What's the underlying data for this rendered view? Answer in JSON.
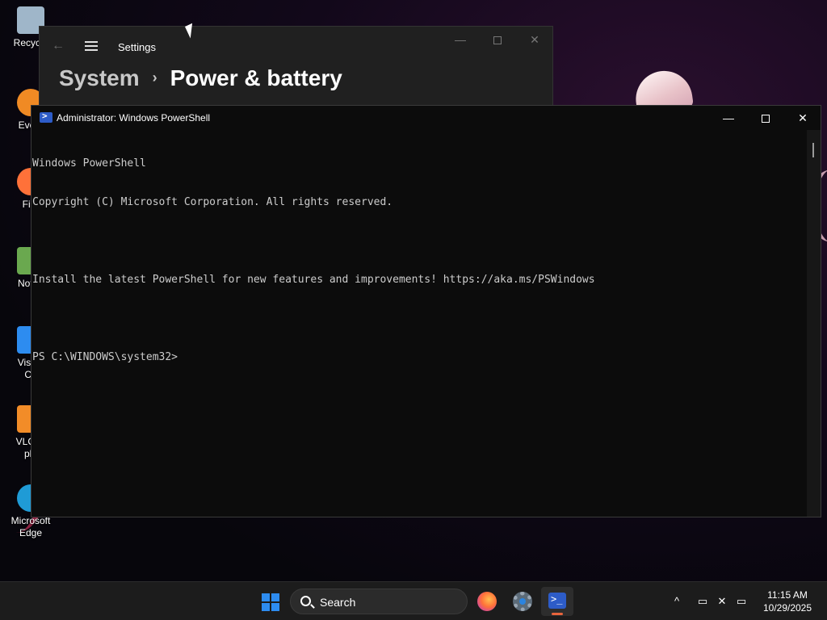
{
  "desktop": {
    "icons": [
      {
        "label": "Recycle",
        "icon": "recycle-bin-icon",
        "color": "#9fb6c9"
      },
      {
        "label": "Every",
        "icon": "everything-icon",
        "color": "#f08a24"
      },
      {
        "label": "Fire",
        "icon": "firefox-icon",
        "color": "#ff7139"
      },
      {
        "label": "Notep",
        "icon": "notepad-icon",
        "color": "#6aa84f"
      },
      {
        "label": "Visual",
        "label2": "Co",
        "icon": "vscode-icon",
        "color": "#2d8cf0"
      },
      {
        "label": "VLC m",
        "label2": "pla",
        "icon": "vlc-icon",
        "color": "#f28c28"
      },
      {
        "label": "Microsoft",
        "label2": "Edge",
        "icon": "edge-icon",
        "color": "#1f9bd6"
      }
    ]
  },
  "settings": {
    "app_title": "Settings",
    "breadcrumb": {
      "parent": "System",
      "separator": "›",
      "current": "Power & battery"
    },
    "buttons": {
      "back": "←",
      "minimize": "—",
      "close": "✕"
    }
  },
  "powershell": {
    "title": "Administrator: Windows PowerShell",
    "buttons": {
      "minimize": "—",
      "close": "✕"
    },
    "lines": [
      "Windows PowerShell",
      "Copyright (C) Microsoft Corporation. All rights reserved.",
      "",
      "Install the latest PowerShell for new features and improvements! https://aka.ms/PSWindows",
      "",
      "PS C:\\WINDOWS\\system32>"
    ]
  },
  "taskbar": {
    "search_label": "Search",
    "tray": {
      "chevron": "^",
      "network": "▭",
      "volume": "✕",
      "battery": "▭"
    },
    "clock": {
      "time": "11:15 AM",
      "date": "10/29/2025"
    },
    "accent": "#e8643c"
  }
}
